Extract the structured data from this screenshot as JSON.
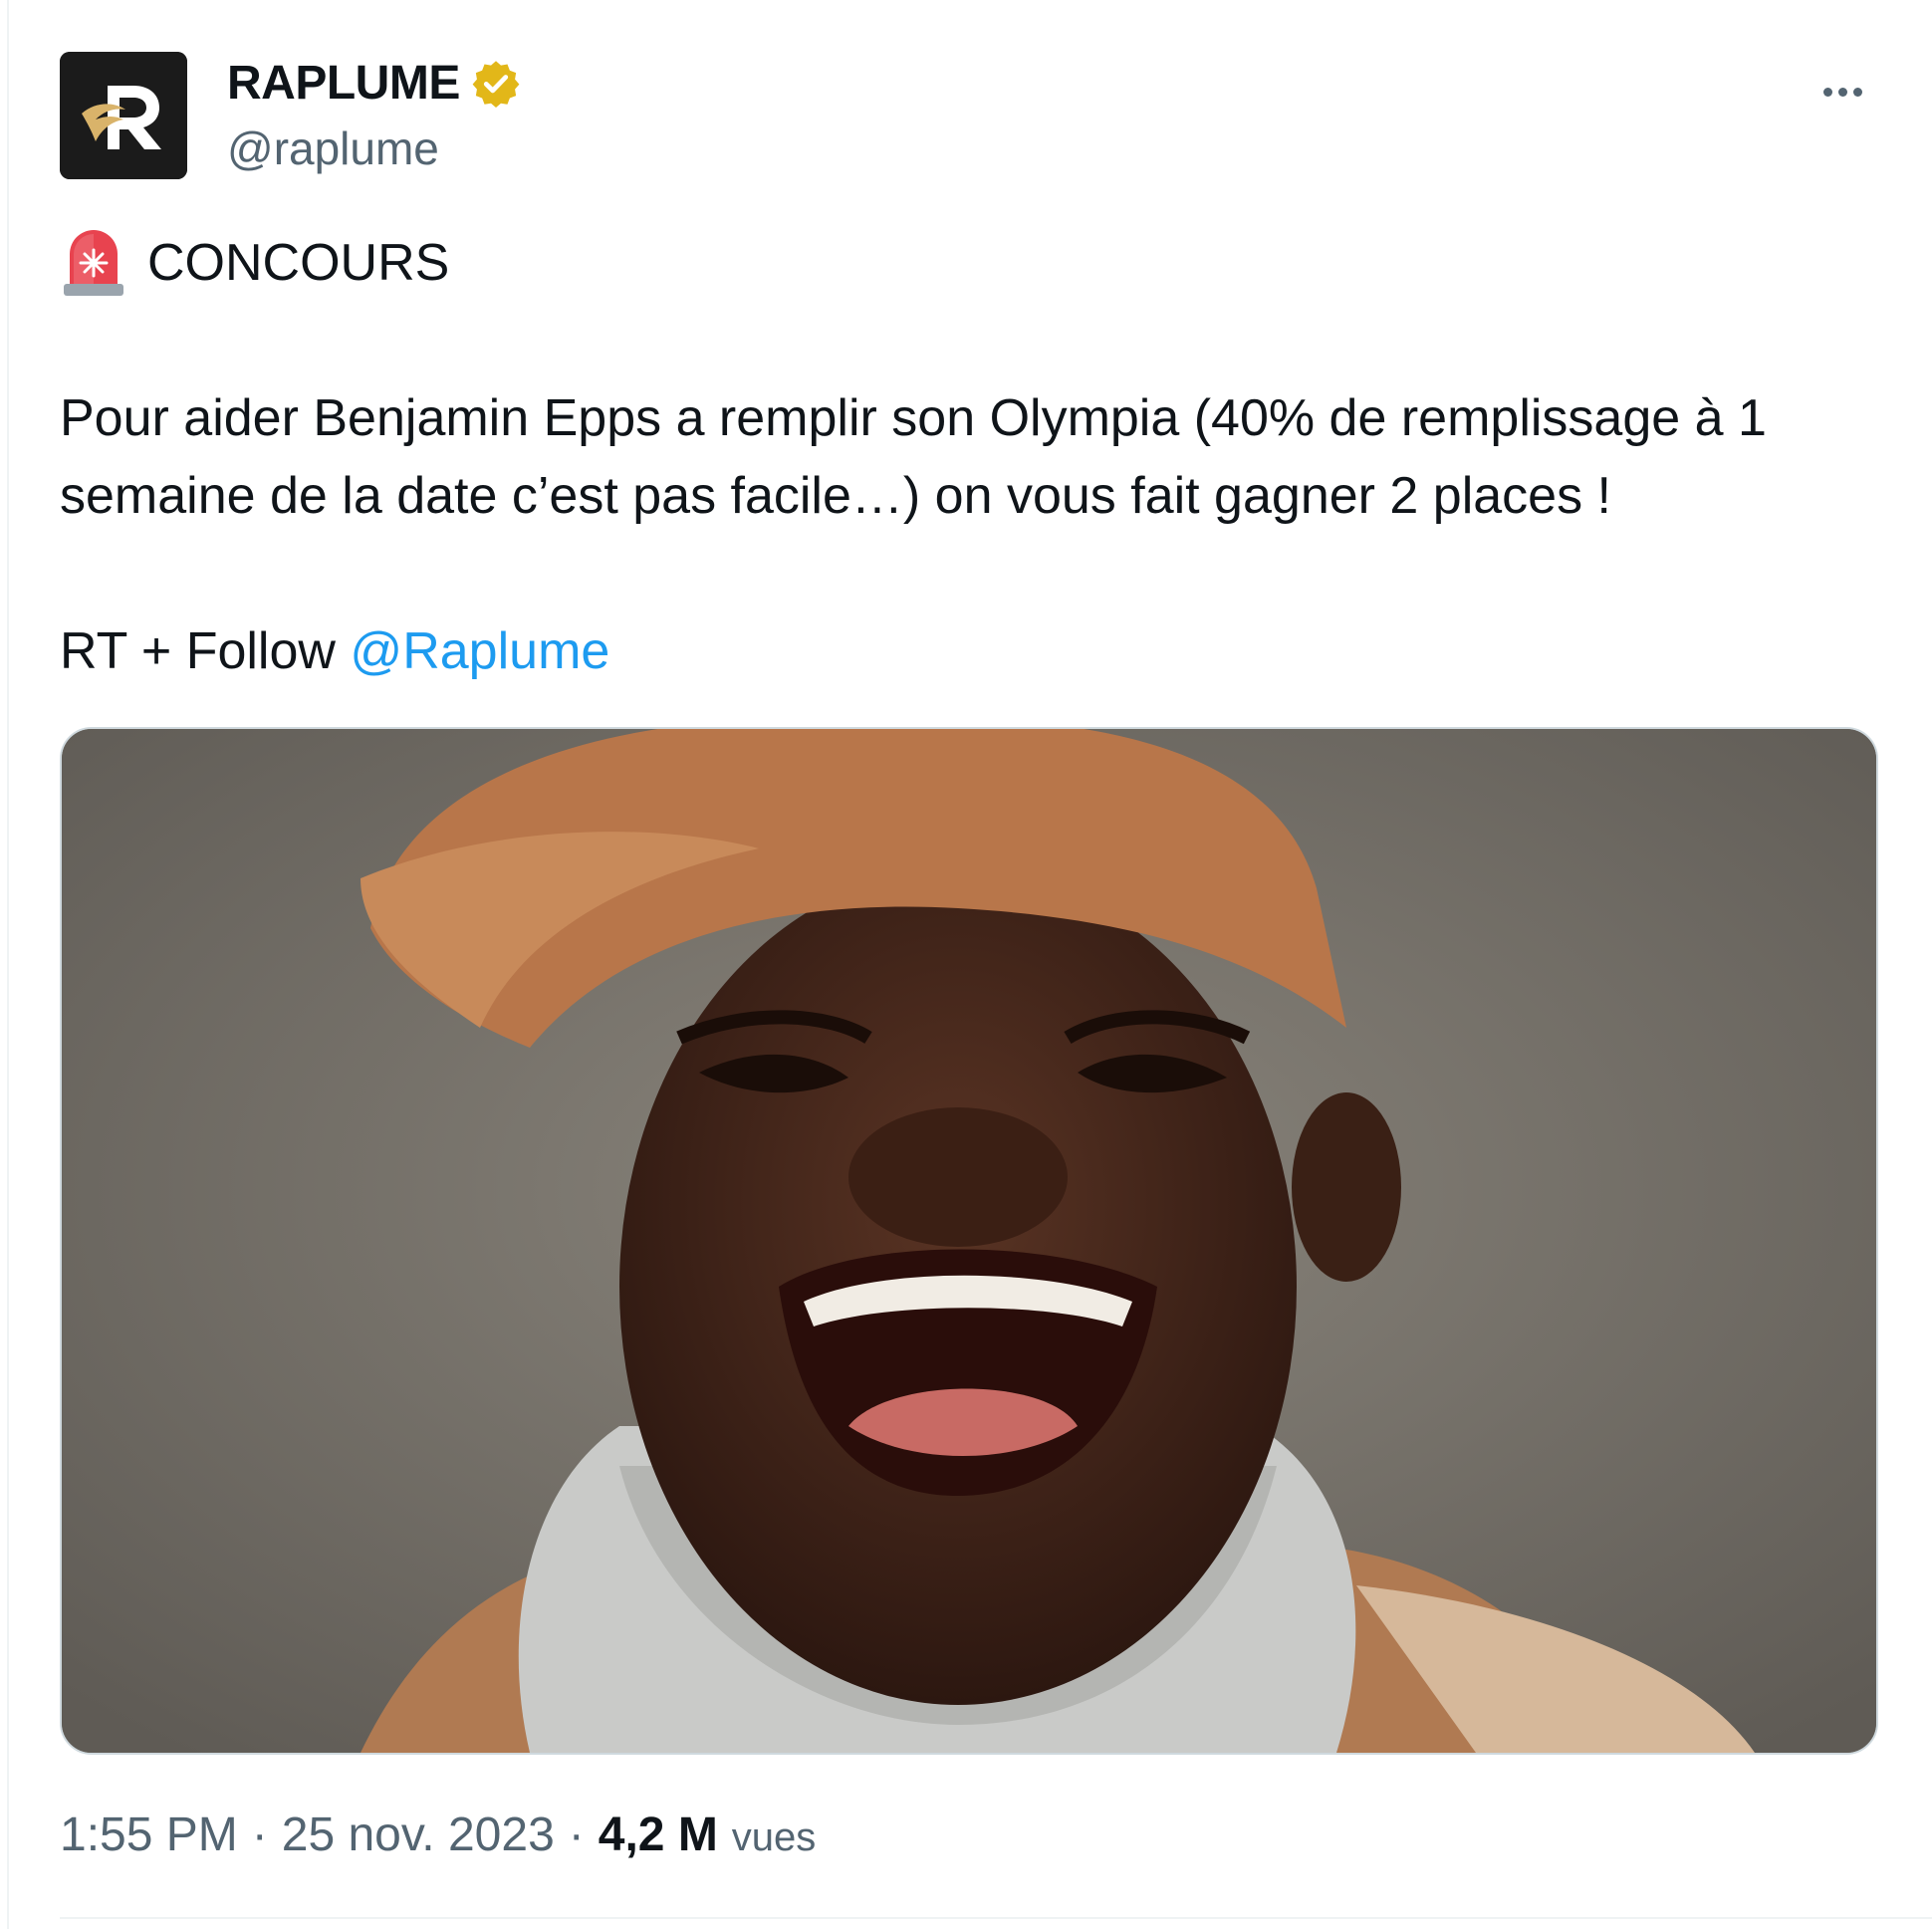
{
  "tweet": {
    "author": {
      "display_name": "RAPLUME",
      "handle": "@raplume",
      "verified": true,
      "avatar_letter": "R"
    },
    "title": "CONCOURS",
    "paragraph": "Pour aider Benjamin Epps a remplir son Olympia (40% de remplissage à 1 semaine de la date c’est pas facile…) on vous fait gagner 2 places !",
    "cta_prefix": "RT + Follow ",
    "mention": "@Raplume",
    "meta": {
      "time": "1:55 PM",
      "date": "25 nov. 2023",
      "views_count": "4,2 M",
      "views_label": "vues"
    }
  },
  "icons": {
    "more": "more-horizontal-icon",
    "verified": "verified-badge-icon",
    "siren": "rotating-light-emoji"
  },
  "colors": {
    "link": "#1d9bf0",
    "muted": "#536471",
    "verified_gold": "#e2b719"
  }
}
